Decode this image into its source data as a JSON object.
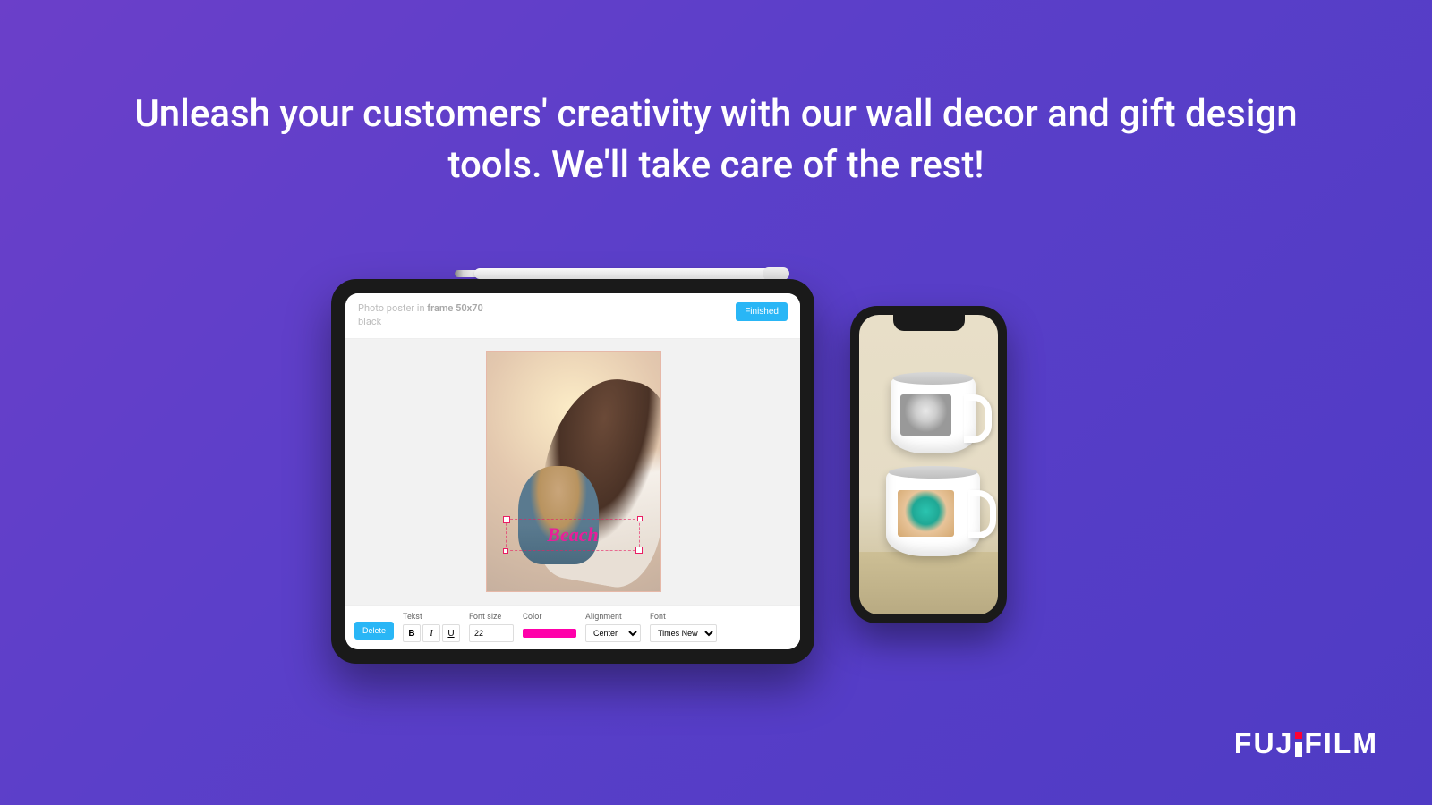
{
  "headline": "Unleash your customers' creativity with our wall decor and gift design tools. We'll take care of the rest!",
  "tablet": {
    "product_prefix": "Photo poster in ",
    "product_strong": "frame 50x70",
    "product_line2": "black",
    "finished_label": "Finished",
    "overlay_text": "Beach",
    "toolbar": {
      "delete_label": "Delete",
      "text_label": "Tekst",
      "bold": "B",
      "italic": "I",
      "underline": "U",
      "fontsize_label": "Font size",
      "fontsize_value": "22",
      "color_label": "Color",
      "alignment_label": "Alignment",
      "alignment_value": "Center",
      "font_label": "Font",
      "font_value": "Times New"
    }
  },
  "brand": {
    "seg1": "FUJ",
    "seg2": "FILM"
  }
}
